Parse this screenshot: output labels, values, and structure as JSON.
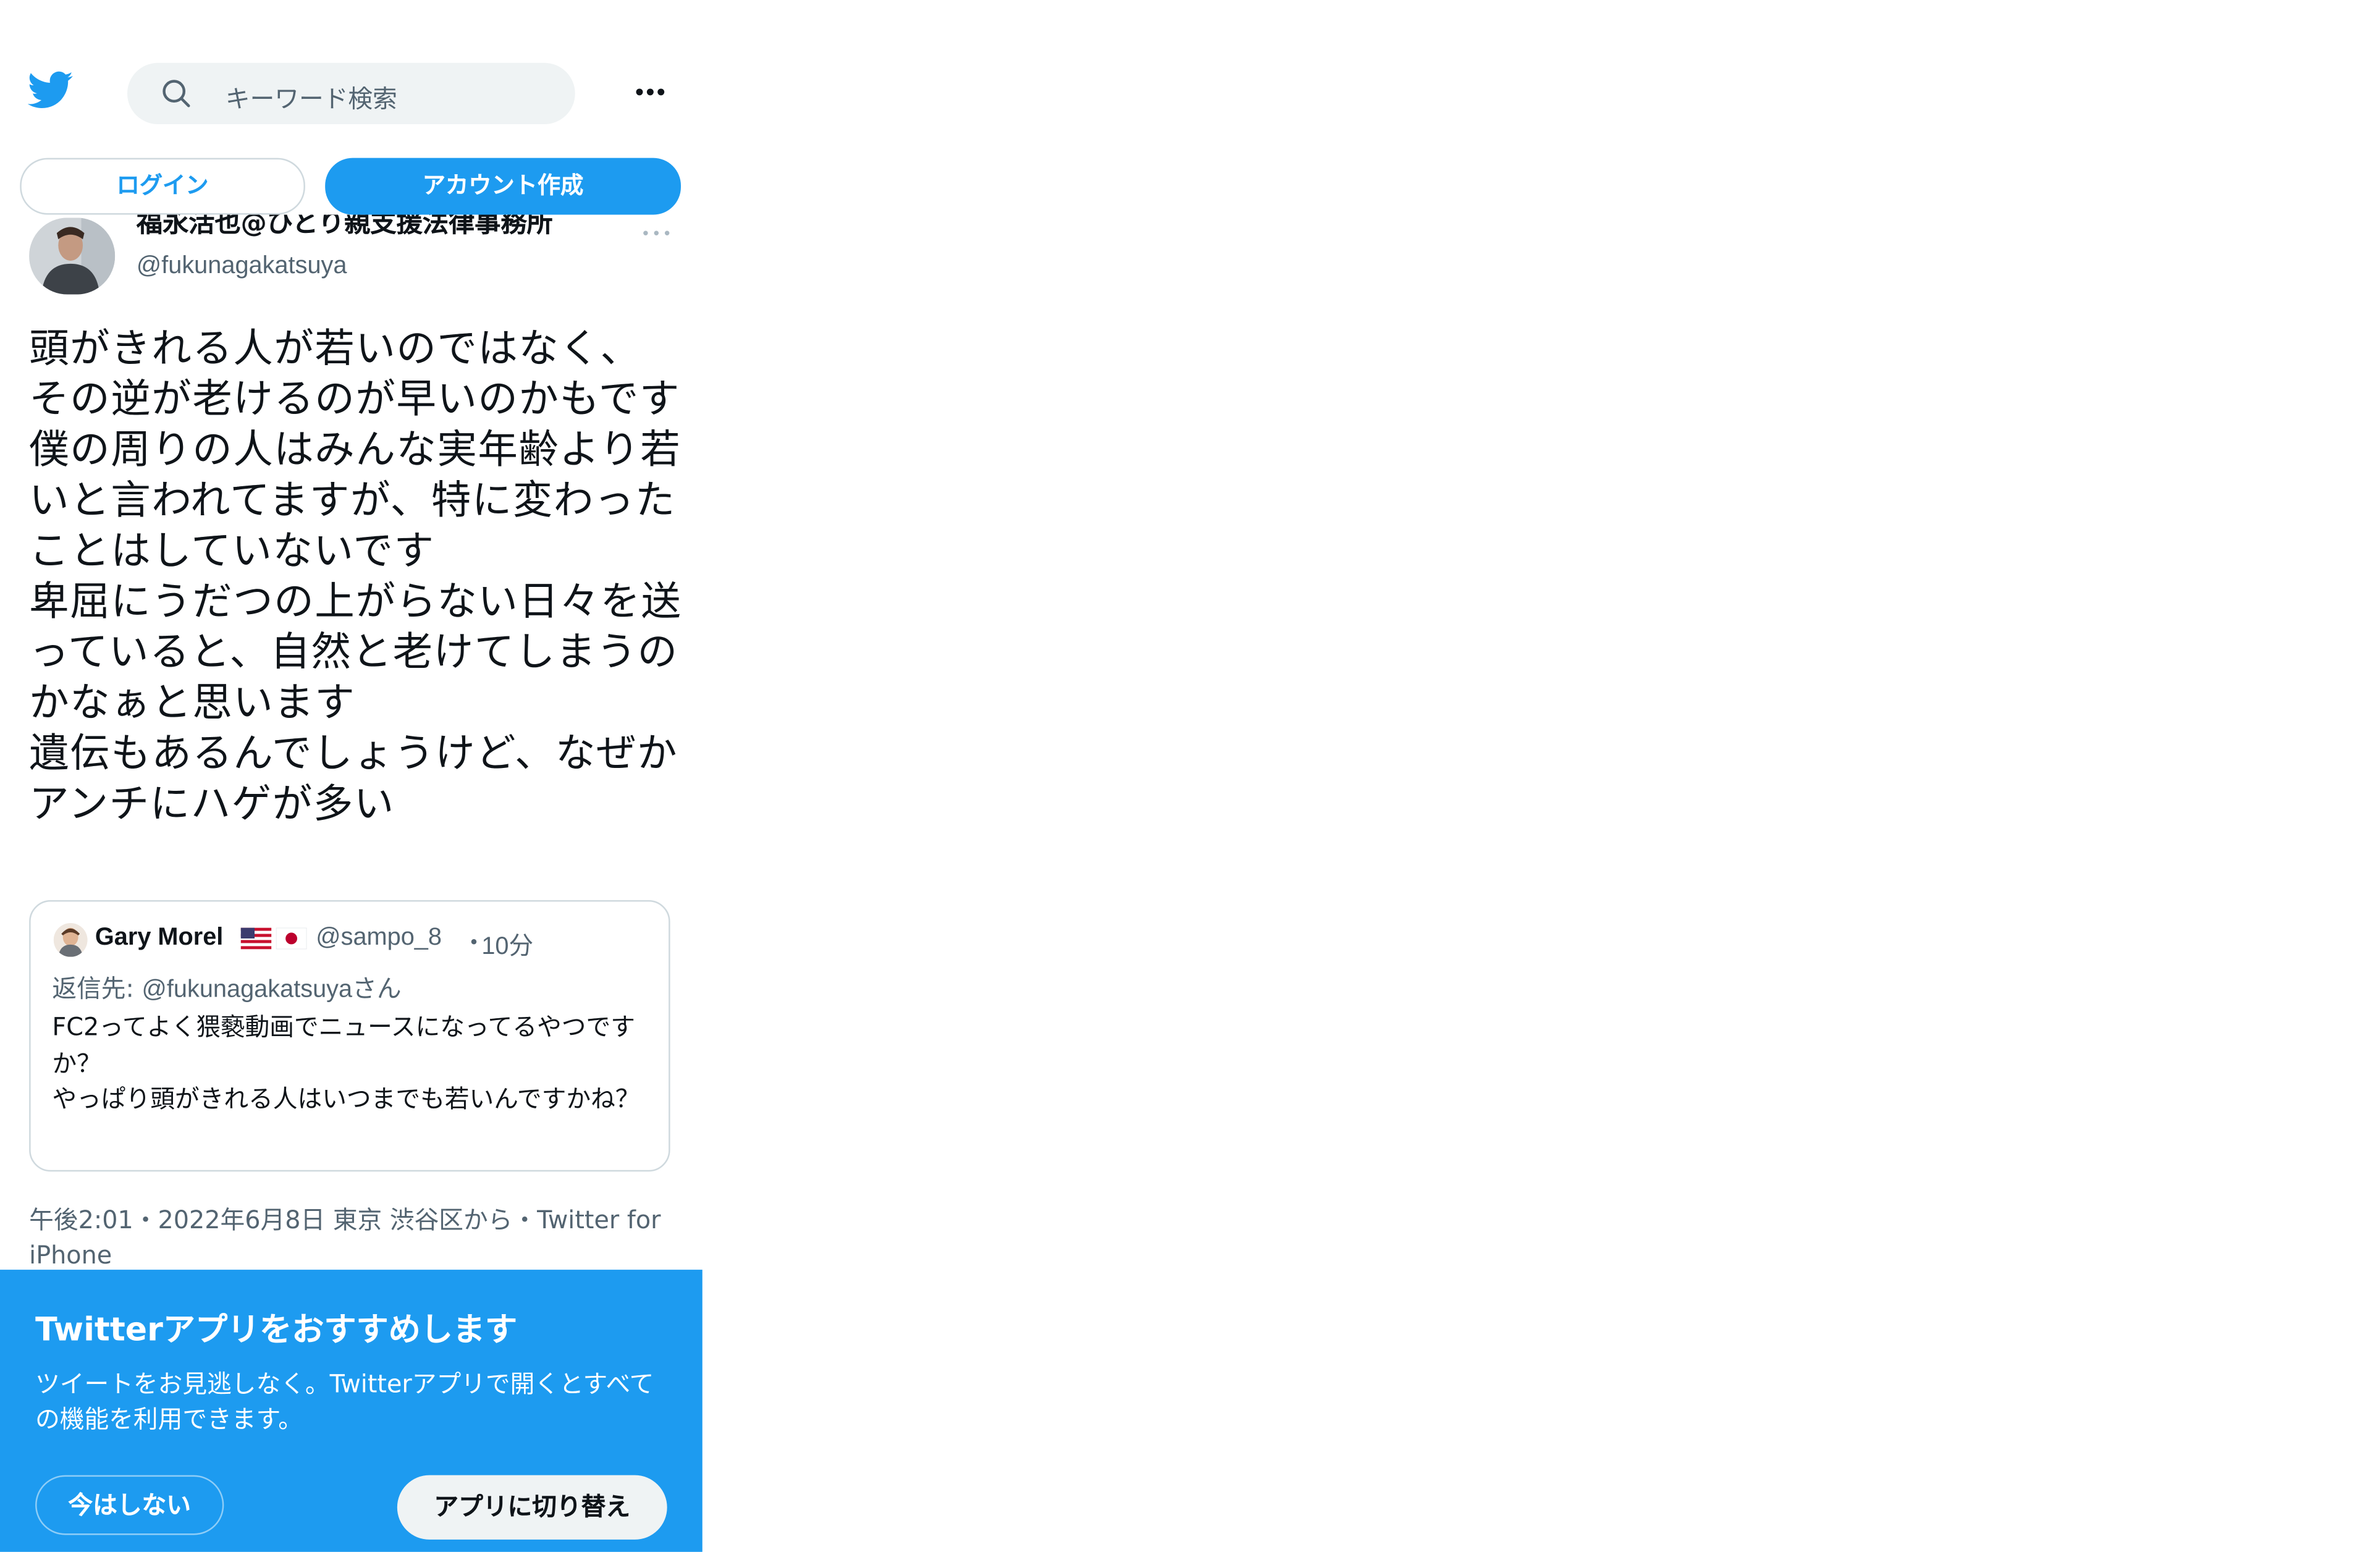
{
  "colors": {
    "brand": "#1d9bf0",
    "text_primary": "#0f1419",
    "text_secondary": "#536471",
    "border": "#cfd9de",
    "search_bg": "#eff3f4"
  },
  "header": {
    "logo_icon": "twitter-bird-icon",
    "search_icon": "search-icon",
    "search_placeholder": "キーワード検索",
    "more_icon": "more-dots-icon"
  },
  "auth": {
    "login_label": "ログイン",
    "signup_label": "アカウント作成"
  },
  "tweet": {
    "author_name": "福永活也@ひとり親支援法律事務所",
    "author_handle": "@fukunagakatsuya",
    "more_icon": "more-dots-icon",
    "text": "頭がきれる人が若いのではなく、\nその逆が老けるのが早いのかもです\n僕の周りの人はみんな実年齢より若いと言われてますが、特に変わったことはしていないです\n卑屈にうだつの上がらない日々を送っていると、自然と老けてしまうのかなぁと思います\n遺伝もあるんでしょうけど、なぜかアンチにハゲが多い",
    "meta": "午後2:01・2022年6月8日 東京 渋谷区から・Twitter for iPhone"
  },
  "quoted_tweet": {
    "author_name": "Gary Morel",
    "flags": [
      "us-flag-icon",
      "jp-flag-icon"
    ],
    "author_handle": "@sampo_8",
    "separator": "・",
    "time": "10分",
    "reply_label": "返信先: ",
    "reply_handle": "@fukunagakatsuya",
    "reply_suffix": "さん",
    "text": "FC2ってよく猥褻動画でニュースになってるやつですか？\nやっぱり頭がきれる人はいつまでも若いんですかね？"
  },
  "app_banner": {
    "title": "Twitterアプリをおすすめします",
    "description": "ツイートをお見逃しなく。Twitterアプリで開くとすべての機能を利用できます。",
    "not_now_label": "今はしない",
    "switch_label": "アプリに切り替え"
  }
}
